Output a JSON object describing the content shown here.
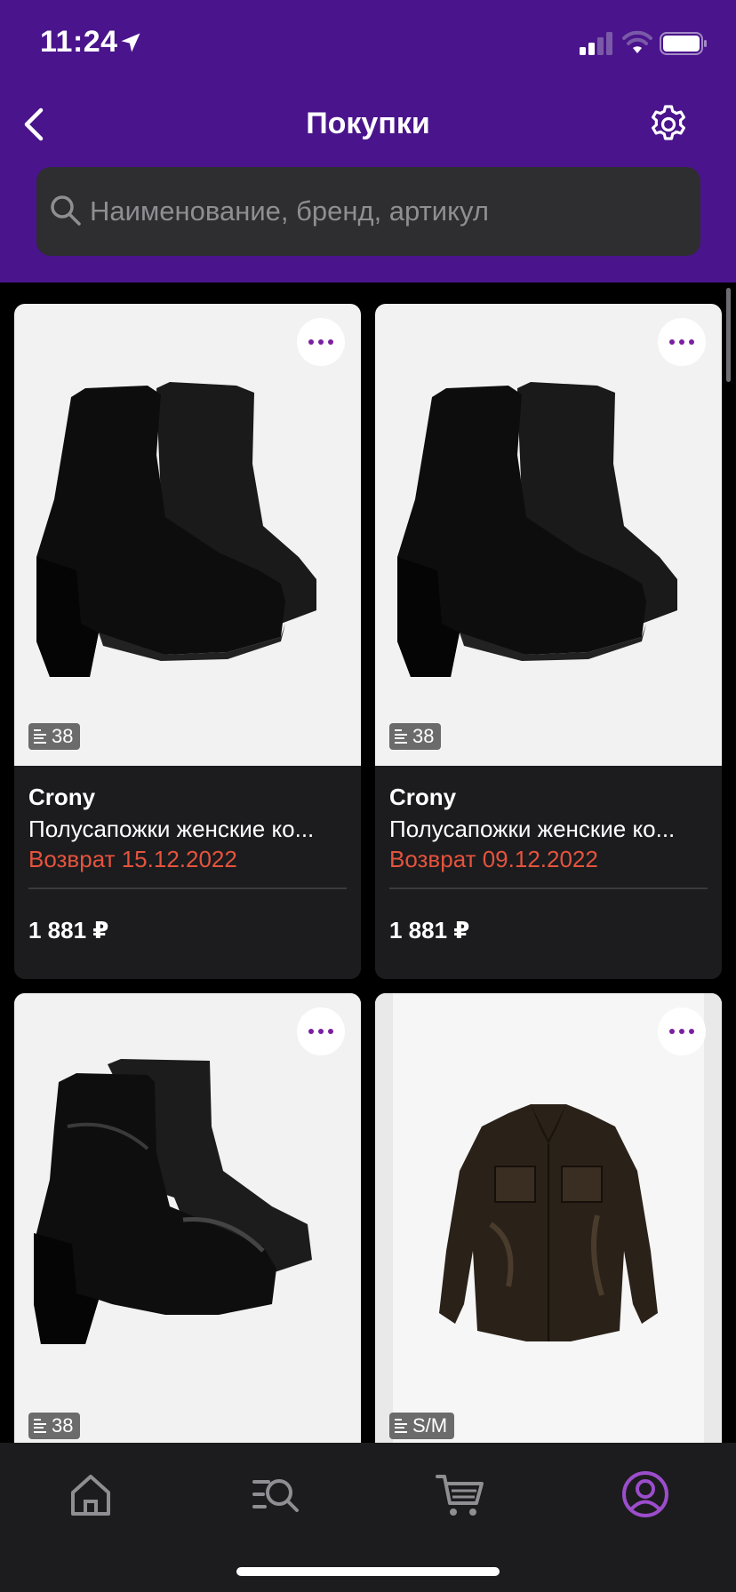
{
  "status_bar": {
    "time": "11:24"
  },
  "header": {
    "title": "Покупки",
    "search_placeholder": "Наименование, бренд, артикул"
  },
  "colors": {
    "header_bg": "#4a148c",
    "accent_purple": "#7b1fa2",
    "return_red": "#e5533d",
    "tab_active": "#9c4dcc"
  },
  "products": [
    {
      "brand": "Crony",
      "name": "Полусапожки женские ко...",
      "status": "Возврат 15.12.2022",
      "price": "1 881 ₽",
      "size": "38",
      "image": "black-suede-platform-boots"
    },
    {
      "brand": "Crony",
      "name": "Полусапожки женские ко...",
      "status": "Возврат 09.12.2022",
      "price": "1 881 ₽",
      "size": "38",
      "image": "black-suede-platform-boots"
    },
    {
      "size": "38",
      "image": "black-leather-platform-boots"
    },
    {
      "size": "S/M",
      "image": "brown-leather-jacket"
    }
  ],
  "tab_bar": {
    "items": [
      {
        "icon": "home-icon"
      },
      {
        "icon": "catalog-search-icon"
      },
      {
        "icon": "cart-icon"
      },
      {
        "icon": "profile-icon",
        "active": true
      }
    ]
  }
}
